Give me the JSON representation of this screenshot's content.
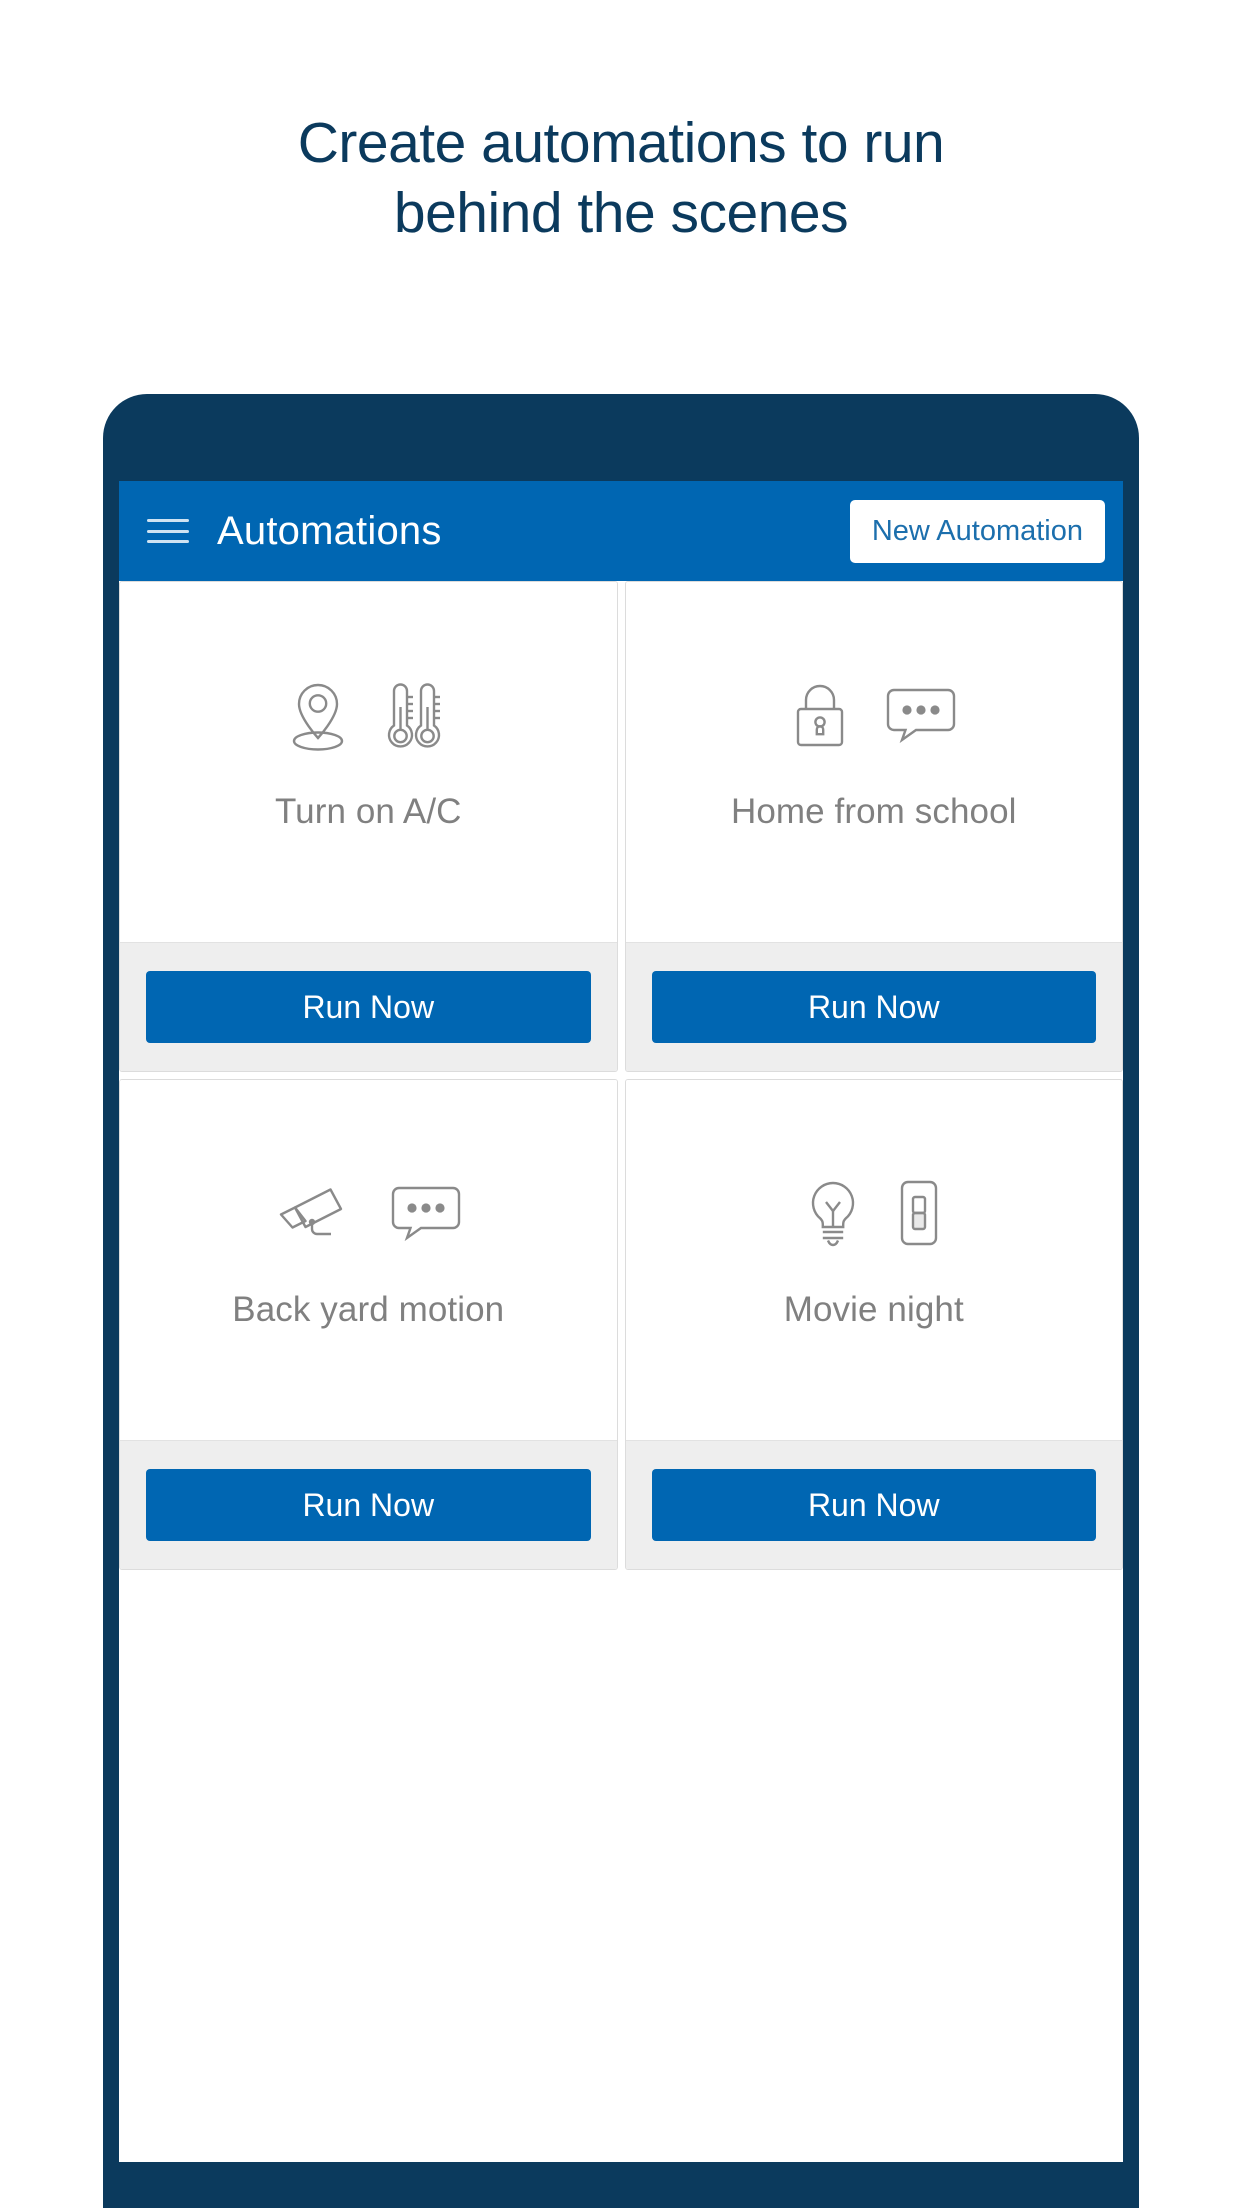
{
  "headline": {
    "line1": "Create automations to run",
    "line2": "behind the scenes"
  },
  "colors": {
    "headline_navy": "#0B3A5D",
    "phone_frame": "#0B3A5D",
    "appbar_blue": "#0066B2",
    "button_blue": "#0066B2",
    "button_text_blue": "#1C6FAD",
    "card_label_gray": "#808080",
    "card_footer_gray": "#eeeeee",
    "card_border": "#dcdcdc"
  },
  "appbar": {
    "menu_icon": "hamburger-menu-icon",
    "title": "Automations",
    "new_automation_label": "New Automation"
  },
  "cards": [
    {
      "label": "Turn on A/C",
      "icons": [
        "location-pin-icon",
        "thermometer-icon"
      ],
      "run_label": "Run Now"
    },
    {
      "label": "Home from school",
      "icons": [
        "lock-icon",
        "message-bubble-icon"
      ],
      "run_label": "Run Now"
    },
    {
      "label": "Back yard motion",
      "icons": [
        "security-camera-icon",
        "message-bubble-icon"
      ],
      "run_label": "Run Now"
    },
    {
      "label": "Movie night",
      "icons": [
        "light-bulb-icon",
        "light-switch-icon"
      ],
      "run_label": "Run Now"
    }
  ]
}
